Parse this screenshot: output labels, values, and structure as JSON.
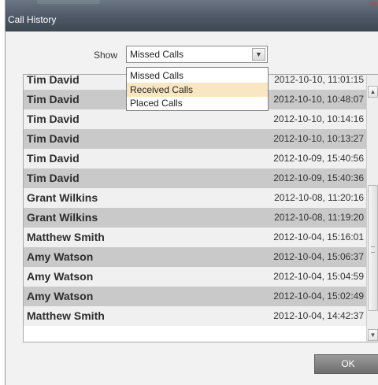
{
  "window": {
    "title": "Call History"
  },
  "filter": {
    "label": "Show",
    "selected": "Missed Calls",
    "options": [
      "Missed Calls",
      "Received Calls",
      "Placed Calls"
    ],
    "highlighted_option": "Received Calls"
  },
  "calls": [
    {
      "name": "Tim David",
      "date": "2012-10-10, 11:01:15"
    },
    {
      "name": "Tim David",
      "date": "2012-10-10, 10:48:07"
    },
    {
      "name": "Tim David",
      "date": "2012-10-10, 10:14:16"
    },
    {
      "name": "Tim David",
      "date": "2012-10-10, 10:13:27"
    },
    {
      "name": "Tim David",
      "date": "2012-10-09, 15:40:56"
    },
    {
      "name": "Tim David",
      "date": "2012-10-09, 15:40:36"
    },
    {
      "name": "Grant Wilkins",
      "date": "2012-10-08, 11:20:16"
    },
    {
      "name": "Grant Wilkins",
      "date": "2012-10-08, 11:19:20"
    },
    {
      "name": "Matthew Smith",
      "date": "2012-10-04, 15:16:01"
    },
    {
      "name": "Amy Watson",
      "date": "2012-10-04, 15:06:37"
    },
    {
      "name": "Amy Watson",
      "date": "2012-10-04, 15:04:59"
    },
    {
      "name": "Amy Watson",
      "date": "2012-10-04, 15:02:49"
    },
    {
      "name": "Matthew Smith",
      "date": "2012-10-04, 14:42:37"
    }
  ],
  "footer": {
    "ok_label": "OK"
  }
}
